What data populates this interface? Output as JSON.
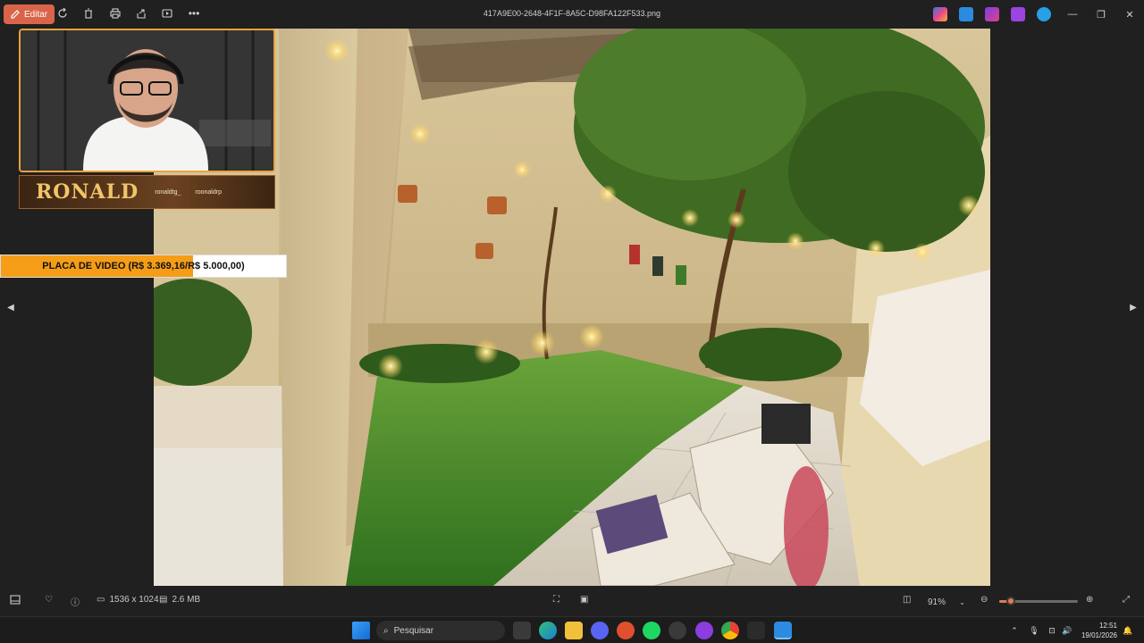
{
  "toolbar": {
    "edit_label": "Editar",
    "filename": "417A9E00-2648-4F1F-8A5C-D98FA122F533.png"
  },
  "overlay": {
    "streamer_name": "RONALD",
    "handle_1": "ronaldtg_",
    "handle_2": "roonaldrp",
    "goal_text": "PLACA DE VIDEO (R$ 3.369,16/R$ 5.000,00)",
    "goal_current": 3369.16,
    "goal_target": 5000.0,
    "goal_color": "#f59d17"
  },
  "statusbar": {
    "dimensions": "1536 x 1024",
    "filesize": "2.6 MB",
    "zoom": "91%",
    "zoom_fraction": 0.15,
    "accent": "#e07a55"
  },
  "taskbar": {
    "search_placeholder": "Pesquisar",
    "time": "12:51",
    "date": "19/01/2026"
  }
}
